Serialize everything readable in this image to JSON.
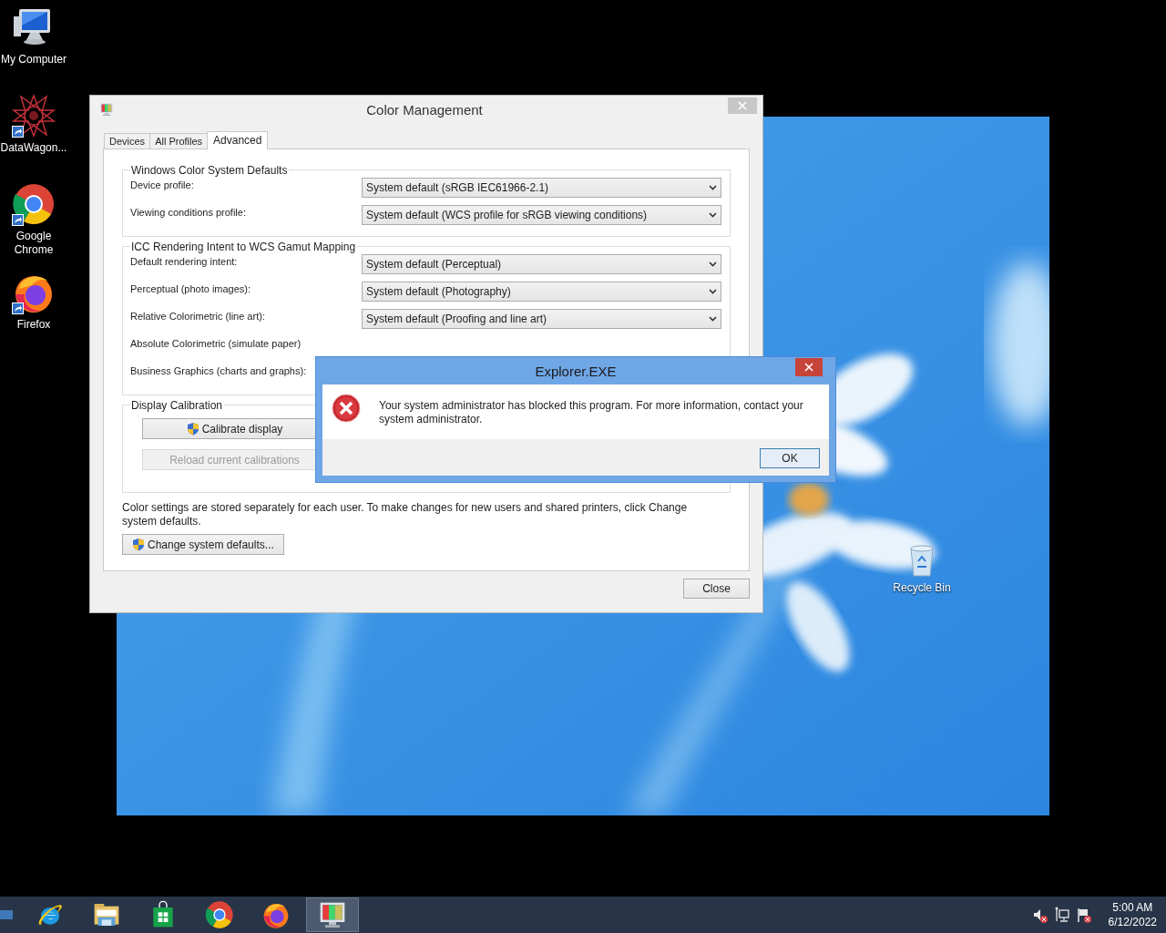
{
  "desktop_icons": [
    {
      "kind": "computer",
      "label": "My Computer",
      "shortcut": false
    },
    {
      "kind": "star",
      "label": "DataWagon...",
      "shortcut": true
    },
    {
      "kind": "chrome",
      "label": "Google Chrome",
      "shortcut": true
    },
    {
      "kind": "firefox",
      "label": "Firefox",
      "shortcut": true
    }
  ],
  "recycle_bin": {
    "label": "Recycle Bin"
  },
  "color_window": {
    "title": "Color Management",
    "tabs": [
      {
        "label": "Devices",
        "selected": false
      },
      {
        "label": "All Profiles",
        "selected": false
      },
      {
        "label": "Advanced",
        "selected": true
      }
    ],
    "groups": [
      {
        "title": "Windows Color System Defaults",
        "rows": [
          {
            "label": "Device profile:",
            "value": "System default (sRGB IEC61966-2.1)"
          },
          {
            "label": "Viewing conditions profile:",
            "value": "System default (WCS profile for sRGB viewing conditions)"
          }
        ]
      },
      {
        "title": "ICC Rendering Intent to WCS Gamut Mapping",
        "rows": [
          {
            "label": "Default rendering intent:",
            "value": "System default (Perceptual)"
          },
          {
            "label": "Perceptual (photo images):",
            "value": "System default (Photography)"
          },
          {
            "label": "Relative Colorimetric (line art):",
            "value": "System default (Proofing and line art)"
          },
          {
            "label": "Absolute Colorimetric (simulate paper)"
          },
          {
            "label": "Business Graphics (charts and graphs):"
          }
        ]
      }
    ],
    "calibration": {
      "title": "Display Calibration",
      "buttons": [
        {
          "label": "Calibrate display",
          "shield": true,
          "disabled": false
        },
        {
          "label": "Reload current calibrations",
          "shield": false,
          "disabled": true
        }
      ]
    },
    "note": "Color settings are stored separately for each user. To make changes for new users and shared printers, click Change system defaults.",
    "change_button": {
      "label": "Change system defaults...",
      "shield": true
    },
    "close_button": "Close"
  },
  "message_box": {
    "title": "Explorer.EXE",
    "message": "Your system administrator has blocked this program. For more information, contact your system administrator.",
    "ok": "OK"
  },
  "taskbar": {
    "items": [
      {
        "kind": "ie",
        "active": false
      },
      {
        "kind": "folder",
        "active": false
      },
      {
        "kind": "store",
        "active": false
      },
      {
        "kind": "chrome",
        "active": false
      },
      {
        "kind": "firefox",
        "active": false
      },
      {
        "kind": "monitor",
        "active": true
      }
    ],
    "tray": [
      {
        "kind": "speaker"
      },
      {
        "kind": "network"
      },
      {
        "kind": "flag"
      }
    ],
    "time": "5:00 AM",
    "date": "6/12/2022"
  }
}
